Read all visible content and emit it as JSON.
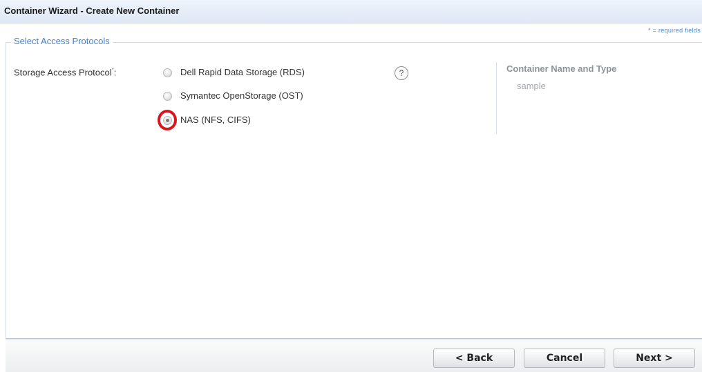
{
  "window": {
    "title": "Container Wizard - Create New Container"
  },
  "form": {
    "required_note": "* = required fields",
    "section_legend": "Select Access Protocols",
    "field_label": "Storage Access Protocol",
    "field_required_mark": "*",
    "field_colon": ":",
    "help_icon_glyph": "?",
    "options": [
      {
        "label": "Dell Rapid Data Storage (RDS)",
        "selected": false
      },
      {
        "label": "Symantec OpenStorage (OST)",
        "selected": false
      },
      {
        "label": "NAS (NFS, CIFS)",
        "selected": true
      }
    ]
  },
  "summary": {
    "title": "Container Name and Type",
    "value": "sample"
  },
  "footer": {
    "back_label": "< Back",
    "cancel_label": "Cancel",
    "next_label": "Next >"
  },
  "colors": {
    "accent": "#3f7fcf",
    "highlight": "#d8141f"
  }
}
